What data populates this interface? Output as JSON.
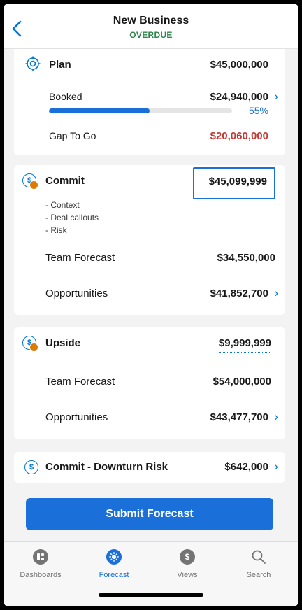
{
  "header": {
    "title": "New Business",
    "status": "OVERDUE"
  },
  "plan": {
    "title": "Plan",
    "amount": "$45,000,000",
    "booked_label": "Booked",
    "booked_amount": "$24,940,000",
    "booked_percent_text": "55%",
    "booked_progress": 0.55,
    "gap_label": "Gap To Go",
    "gap_amount": "$20,060,000"
  },
  "commit": {
    "title": "Commit",
    "amount": "$45,099,999",
    "notes": [
      "- Context",
      "- Deal callouts",
      "- Risk"
    ],
    "team_forecast_label": "Team Forecast",
    "team_forecast_amount": "$34,550,000",
    "opportunities_label": "Opportunities",
    "opportunities_amount": "$41,852,700"
  },
  "upside": {
    "title": "Upside",
    "amount": "$9,999,999",
    "team_forecast_label": "Team Forecast",
    "team_forecast_amount": "$54,000,000",
    "opportunities_label": "Opportunities",
    "opportunities_amount": "$43,477,700"
  },
  "downturn": {
    "title": "Commit - Downturn Risk",
    "amount": "$642,000"
  },
  "submit_label": "Submit Forecast",
  "tabs": [
    {
      "label": "Dashboards",
      "icon": "dashboards-icon"
    },
    {
      "label": "Forecast",
      "icon": "forecast-icon"
    },
    {
      "label": "Views",
      "icon": "views-icon"
    },
    {
      "label": "Search",
      "icon": "search-icon"
    }
  ],
  "colors": {
    "accent": "#1b6fd8",
    "overdue": "#2e844a",
    "gap": "#c23934",
    "badge": "#dd7a01"
  }
}
